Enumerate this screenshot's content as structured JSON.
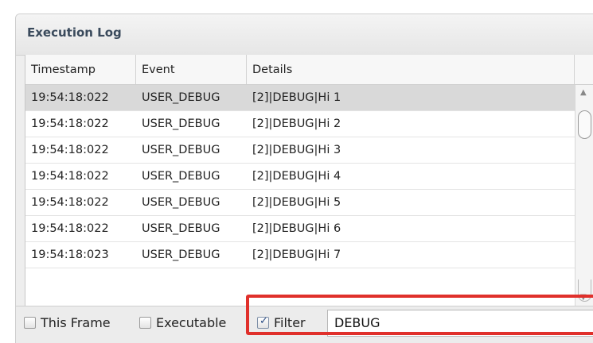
{
  "panel": {
    "title": "Execution Log"
  },
  "columns": [
    "Timestamp",
    "Event",
    "Details"
  ],
  "rows": [
    {
      "timestamp": "19:54:18:022",
      "event": "USER_DEBUG",
      "details": "[2]|DEBUG|Hi 1",
      "selected": true
    },
    {
      "timestamp": "19:54:18:022",
      "event": "USER_DEBUG",
      "details": "[2]|DEBUG|Hi 2"
    },
    {
      "timestamp": "19:54:18:022",
      "event": "USER_DEBUG",
      "details": "[2]|DEBUG|Hi 3"
    },
    {
      "timestamp": "19:54:18:022",
      "event": "USER_DEBUG",
      "details": "[2]|DEBUG|Hi 4"
    },
    {
      "timestamp": "19:54:18:022",
      "event": "USER_DEBUG",
      "details": "[2]|DEBUG|Hi 5"
    },
    {
      "timestamp": "19:54:18:022",
      "event": "USER_DEBUG",
      "details": "[2]|DEBUG|Hi 6"
    },
    {
      "timestamp": "19:54:18:023",
      "event": "USER_DEBUG",
      "details": "[2]|DEBUG|Hi 7"
    }
  ],
  "footer": {
    "this_frame": {
      "label": "This Frame",
      "checked": false
    },
    "executable": {
      "label": "Executable",
      "checked": false
    },
    "filter": {
      "label": "Filter",
      "checked": true,
      "value": "DEBUG"
    }
  },
  "colors": {
    "highlight": "#e0302b",
    "selected_row": "#d9d9d9",
    "title": "#3a4a5c"
  }
}
